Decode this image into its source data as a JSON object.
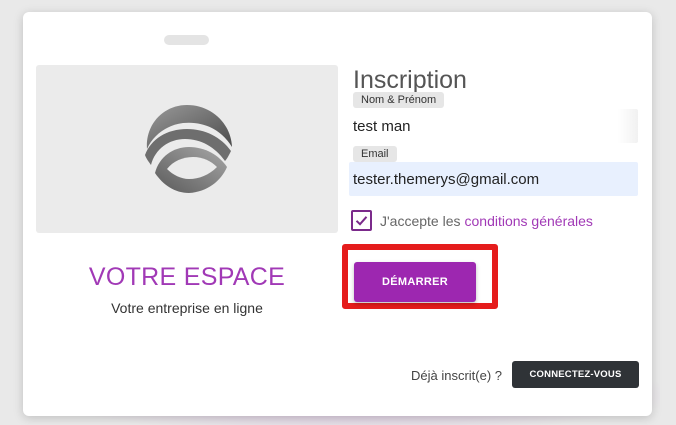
{
  "brand": {
    "title": "VOTRE ESPACE",
    "subtitle": "Votre entreprise en ligne",
    "logo_icon": "swirl-sphere-logo"
  },
  "form": {
    "title": "Inscription",
    "name": {
      "label": "Nom & Prénom",
      "value": "test man"
    },
    "email": {
      "label": "Email",
      "value": "tester.themerys@gmail.com"
    },
    "terms": {
      "checked": true,
      "prefix": "J'accepte les",
      "link": "conditions générales"
    },
    "submit_label": "DÉMARRER"
  },
  "footer": {
    "already_text": "Déjà inscrit(e) ?",
    "login_label": "CONNECTEZ-VOUS"
  },
  "colors": {
    "accent": "#9d27b0",
    "highlight": "#e51c1c",
    "dark_button": "#2f3337"
  }
}
